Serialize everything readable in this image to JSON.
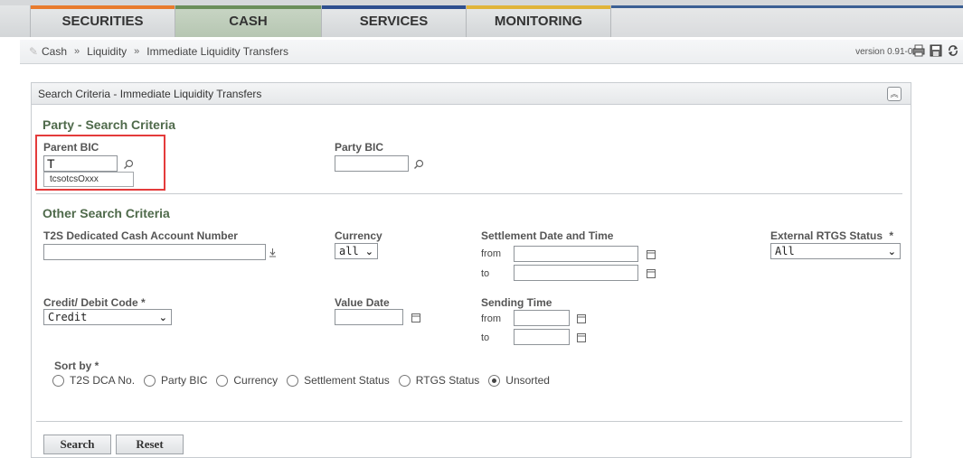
{
  "tabs": [
    {
      "label": "SECURITIES",
      "color": "#e87b2d"
    },
    {
      "label": "CASH",
      "color": "#6b8e5a"
    },
    {
      "label": "SERVICES",
      "color": "#2e4f8f"
    },
    {
      "label": "MONITORING",
      "color": "#e0b43a"
    }
  ],
  "active_tab": "CASH",
  "breadcrumb": [
    "Cash",
    "Liquidity",
    "Immediate Liquidity Transfers"
  ],
  "breadcrumb_sep": "»",
  "version": "version 0.91-03",
  "panel": {
    "title": "Search Criteria - Immediate Liquidity Transfers",
    "party_section": "Party - Search Criteria",
    "parent_bic_label": "Parent BIC",
    "parent_bic_value": "T",
    "parent_bic_suggestion": "tcsotcsOxxx",
    "party_bic_label": "Party BIC",
    "party_bic_value": "",
    "other_section": "Other Search Criteria",
    "t2s_label": "T2S Dedicated Cash Account Number",
    "t2s_value": "",
    "currency_label": "Currency",
    "currency_value": "all",
    "settlement_label": "Settlement Date and Time",
    "from_label": "from",
    "to_label": "to",
    "rtgs_label": "External RTGS Status",
    "required_mark": "*",
    "rtgs_value": "All",
    "credit_debit_label": "Credit/ Debit Code *",
    "credit_debit_value": "Credit",
    "value_date_label": "Value Date",
    "sending_time_label": "Sending Time",
    "sort_by_label": "Sort by *",
    "sort_options": [
      "T2S DCA No.",
      "Party BIC",
      "Currency",
      "Settlement Status",
      "RTGS Status",
      "Unsorted"
    ],
    "sort_selected": "Unsorted"
  },
  "buttons": {
    "search": "Search",
    "reset": "Reset"
  },
  "colors": {
    "highlight": "#e43b3b",
    "section": "#4f6a4b"
  }
}
